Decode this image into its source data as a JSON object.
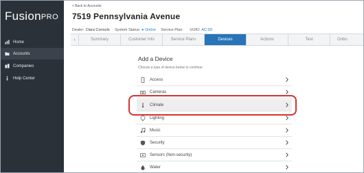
{
  "app": {
    "logo_main": "Fusion",
    "logo_suffix": "PRO"
  },
  "sidebar": {
    "items": [
      {
        "label": "Home",
        "icon": "bar-chart-icon"
      },
      {
        "label": "Accounts",
        "icon": "folder-icon"
      },
      {
        "label": "Companies",
        "icon": "companies-icon"
      },
      {
        "label": "Help Center",
        "icon": "info-icon"
      }
    ],
    "active_index": 1
  },
  "header": {
    "back_link": "< Back to Accounts",
    "address": "7519 Pennsylvania Avenue",
    "dealer_label": "Dealer:",
    "dealer_value": "Clara Connols",
    "status_label": "System Status:",
    "status_value": "● Online",
    "plan_label": "Service Plan:",
    "plan_value": "",
    "uuid_label": "UUID:",
    "uuid_value": "AC:5D"
  },
  "tabs": {
    "items": [
      "Summary",
      "Customer Info",
      "Service Plans",
      "Devices",
      "Actions",
      "Test",
      "Onbo"
    ],
    "active_index": 3,
    "prev_arrow": "‹"
  },
  "content": {
    "title": "Add a Device",
    "subtitle": "Choose a type of device below to continue",
    "devices": [
      {
        "label": "Access",
        "icon": "access-icon"
      },
      {
        "label": "Cameras",
        "icon": "camera-icon"
      },
      {
        "label": "Climate",
        "icon": "thermometer-icon"
      },
      {
        "label": "Lighting",
        "icon": "lighting-icon"
      },
      {
        "label": "Music",
        "icon": "music-icon"
      },
      {
        "label": "Security",
        "icon": "shield-icon"
      },
      {
        "label": "Sensors (Non-security)",
        "icon": "sensor-icon"
      },
      {
        "label": "Water",
        "icon": "water-drop-icon"
      }
    ],
    "highlighted_index": 2
  },
  "colors": {
    "sidebar_bg": "#2b3139",
    "active_tab": "#2874b8",
    "link": "#1e7fc2",
    "highlight_ring": "#d62f2f"
  }
}
